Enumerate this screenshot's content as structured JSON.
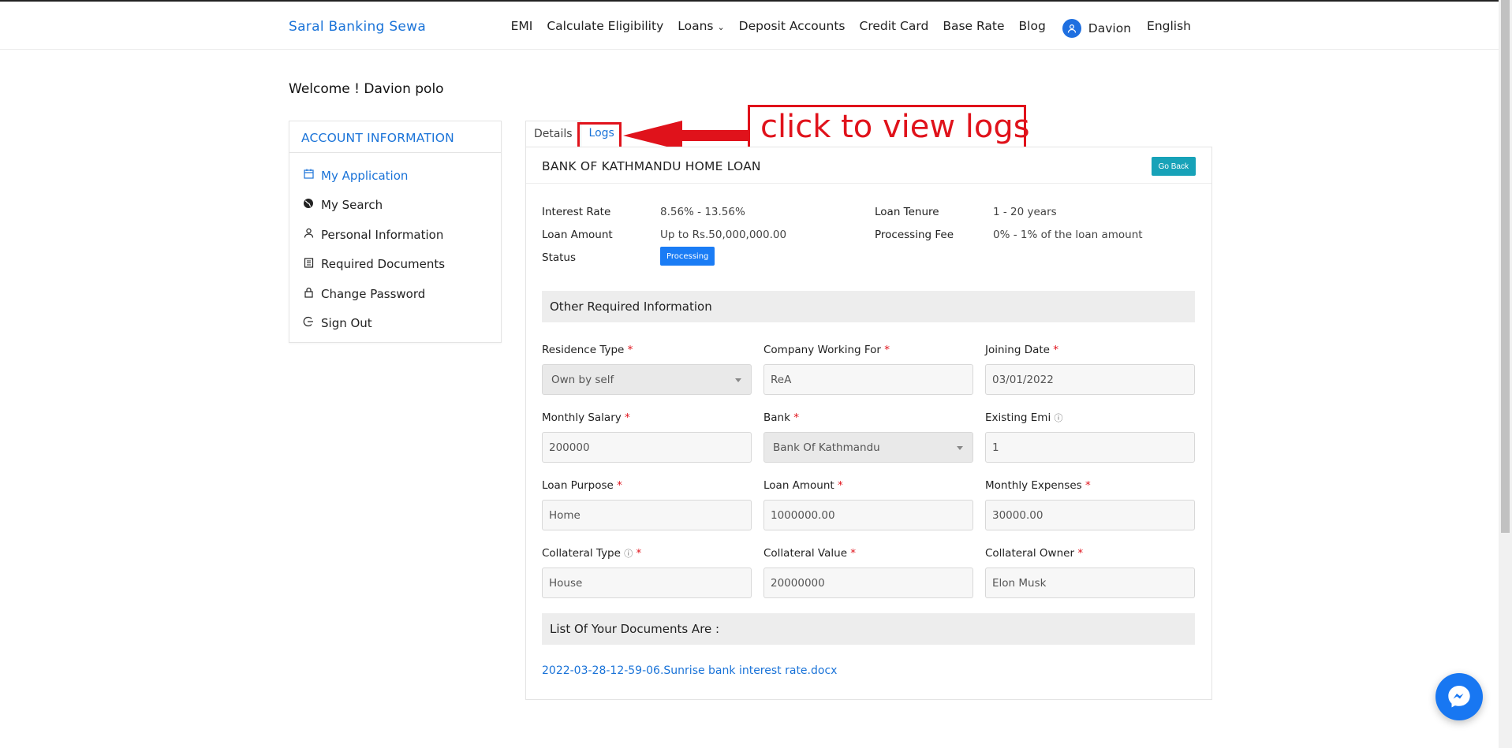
{
  "brand": "Saral Banking Sewa",
  "nav": {
    "items": [
      "EMI",
      "Calculate Eligibility",
      "Loans",
      "Deposit Accounts",
      "Credit Card",
      "Base Rate",
      "Blog"
    ],
    "user": "Davion",
    "language": "English"
  },
  "welcome": "Welcome ! Davion polo",
  "sidebar": {
    "title": "ACCOUNT INFORMATION",
    "items": [
      {
        "label": "My Application",
        "icon": "calendar-icon"
      },
      {
        "label": "My Search",
        "icon": "globe-icon"
      },
      {
        "label": "Personal Information",
        "icon": "user-icon"
      },
      {
        "label": "Required Documents",
        "icon": "document-icon"
      },
      {
        "label": "Change Password",
        "icon": "lock-icon"
      },
      {
        "label": "Sign Out",
        "icon": "sign-out-icon"
      }
    ]
  },
  "tabs": {
    "details": "Details",
    "logs": "Logs"
  },
  "callout": "click to view logs",
  "loan": {
    "title": "BANK OF KATHMANDU HOME LOAN",
    "go_back": "Go Back",
    "interest_rate_label": "Interest Rate",
    "interest_rate": "8.56% - 13.56%",
    "loan_amount_label": "Loan Amount",
    "loan_amount": "Up to Rs.50,000,000.00",
    "status_label": "Status",
    "status": "Processing",
    "tenure_label": "Loan Tenure",
    "tenure": "1 - 20 years",
    "fee_label": "Processing Fee",
    "fee": "0% - 1% of the loan amount"
  },
  "other_info_title": "Other Required Information",
  "fields": {
    "residence_type": {
      "label": "Residence Type",
      "value": "Own by self"
    },
    "company": {
      "label": "Company Working For",
      "value": "ReA"
    },
    "joining_date": {
      "label": "Joining Date",
      "value": "03/01/2022"
    },
    "monthly_salary": {
      "label": "Monthly Salary",
      "value": "200000"
    },
    "bank": {
      "label": "Bank",
      "value": "Bank Of Kathmandu"
    },
    "existing_emi": {
      "label": "Existing Emi",
      "value": "1"
    },
    "loan_purpose": {
      "label": "Loan Purpose",
      "value": "Home"
    },
    "loan_amount": {
      "label": "Loan Amount",
      "value": "1000000.00"
    },
    "monthly_expenses": {
      "label": "Monthly Expenses",
      "value": "30000.00"
    },
    "collateral_type": {
      "label": "Collateral Type",
      "value": "House"
    },
    "collateral_value": {
      "label": "Collateral Value",
      "value": "20000000"
    },
    "collateral_owner": {
      "label": "Collateral Owner",
      "value": "Elon Musk"
    }
  },
  "documents_title": "List Of Your Documents Are :",
  "document_link": "2022-03-28-12-59-06.Sunrise bank interest rate.docx",
  "colors": {
    "accent": "#1a73d8",
    "callout_red": "#e0121b",
    "go_back": "#17a2b8",
    "status": "#1a7cf5"
  }
}
